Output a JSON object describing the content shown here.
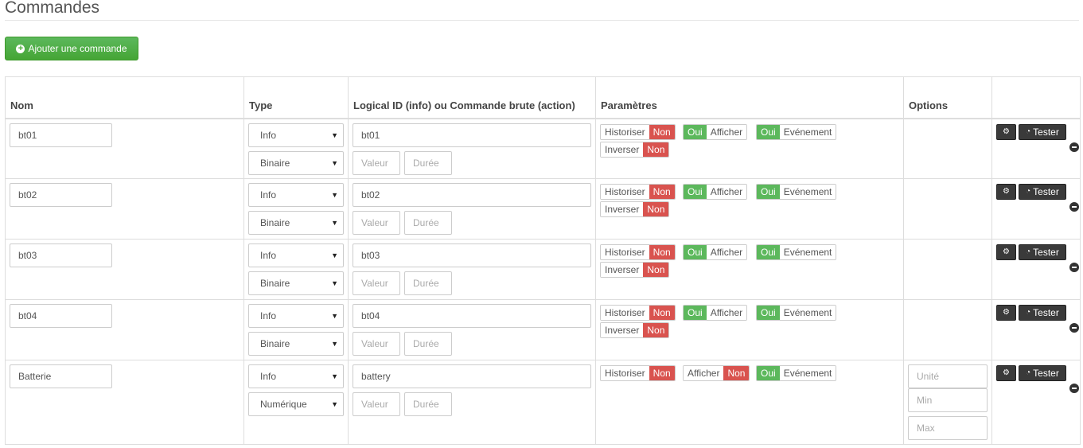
{
  "page": {
    "legend": "Commandes",
    "add_button": "Ajouter une commande"
  },
  "table": {
    "headers": {
      "name": "Nom",
      "type": "Type",
      "logical_id": "Logical ID (info) ou Commande brute (action)",
      "params": "Paramètres",
      "options": "Options"
    },
    "labels": {
      "historiser": "Historiser",
      "afficher": "Afficher",
      "evenement": "Evénement",
      "inverser": "Inverser",
      "yes": "Oui",
      "no": "Non",
      "configure": "",
      "test": "Tester",
      "valeur_placeholder": "Valeur",
      "duree_placeholder": "Durée",
      "unite_placeholder": "Unité",
      "min_placeholder": "Min",
      "max_placeholder": "Max"
    },
    "rows": [
      {
        "name": "bt01",
        "type": "Info",
        "subtype": "Binaire",
        "logical_id": "bt01",
        "historiser": "Non",
        "afficher": "Oui",
        "evenement": "Oui",
        "inverser": "Non"
      },
      {
        "name": "bt02",
        "type": "Info",
        "subtype": "Binaire",
        "logical_id": "bt02",
        "historiser": "Non",
        "afficher": "Oui",
        "evenement": "Oui",
        "inverser": "Non"
      },
      {
        "name": "bt03",
        "type": "Info",
        "subtype": "Binaire",
        "logical_id": "bt03",
        "historiser": "Non",
        "afficher": "Oui",
        "evenement": "Oui",
        "inverser": "Non"
      },
      {
        "name": "bt04",
        "type": "Info",
        "subtype": "Binaire",
        "logical_id": "bt04",
        "historiser": "Non",
        "afficher": "Oui",
        "evenement": "Oui",
        "inverser": "Non"
      },
      {
        "name": "Batterie",
        "type": "Info",
        "subtype": "Numérique",
        "logical_id": "battery",
        "historiser": "Non",
        "afficher": "Non",
        "evenement": "Oui"
      }
    ]
  },
  "colors": {
    "success": "#5cb85c",
    "danger": "#d9534f",
    "dark": "#3a3a3a"
  }
}
